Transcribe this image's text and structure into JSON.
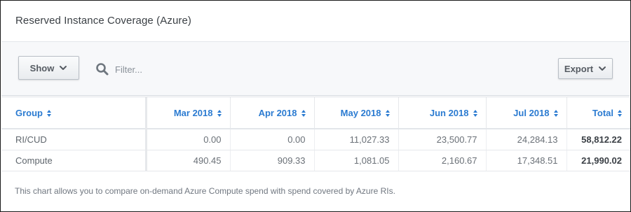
{
  "panel": {
    "title": "Reserved Instance Coverage (Azure)"
  },
  "toolbar": {
    "show_label": "Show",
    "filter_placeholder": "Filter...",
    "export_label": "Export"
  },
  "table": {
    "columns": [
      "Group",
      "Mar 2018",
      "Apr 2018",
      "May 2018",
      "Jun 2018",
      "Jul 2018",
      "Total"
    ],
    "rows": [
      {
        "group": "RI/CUD",
        "values": [
          "0.00",
          "0.00",
          "11,027.33",
          "23,500.77",
          "24,284.13"
        ],
        "total": "58,812.22"
      },
      {
        "group": "Compute",
        "values": [
          "490.45",
          "909.33",
          "1,081.05",
          "2,160.67",
          "17,348.51"
        ],
        "total": "21,990.02"
      }
    ]
  },
  "footnote": "This chart allows you to compare on-demand Azure Compute spend with spend covered by Azure RIs.",
  "colors": {
    "accent": "#2b7bd1",
    "text": "#6a7077",
    "toolbar_bg": "#f7f8fa"
  }
}
